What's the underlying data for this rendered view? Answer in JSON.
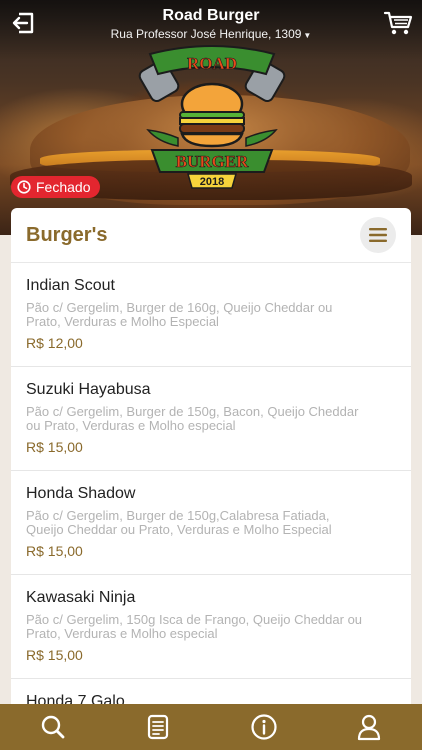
{
  "header": {
    "store_name": "Road Burger",
    "address": "Rua Professor José Henrique, 1309"
  },
  "logo": {
    "line1": "ROAD",
    "line2": "BURGER",
    "year": "2018"
  },
  "status": {
    "label": "Fechado",
    "color": "#e3262f"
  },
  "category": {
    "title": "Burger's"
  },
  "items": [
    {
      "name": "Indian Scout",
      "desc_line1": "Pão c/ Gergelim, Burger de 160g, Queijo Cheddar ou",
      "desc_line2": "Prato, Verduras e Molho Especial",
      "price": "R$ 12,00"
    },
    {
      "name": "Suzuki Hayabusa",
      "desc_line1": "Pão c/ Gergelim, Burger de 150g, Bacon, Queijo Cheddar",
      "desc_line2": "ou Prato, Verduras e Molho especial",
      "price": "R$ 15,00"
    },
    {
      "name": "Honda Shadow",
      "desc_line1": "Pão c/ Gergelim, Burger de 150g,Calabresa Fatiada,",
      "desc_line2": "Queijo Cheddar ou Prato, Verduras e Molho Especial",
      "price": "R$ 15,00"
    },
    {
      "name": "Kawasaki Ninja",
      "desc_line1": "Pão c/ Gergelim, 150g Isca de Frango, Queijo Cheddar ou",
      "desc_line2": "Prato, Verduras e Molho especial",
      "price": "R$ 15,00"
    },
    {
      "name": "Honda 7 Galo",
      "desc_line1": "",
      "desc_line2": "",
      "price": ""
    }
  ],
  "nav": {
    "icons": [
      "search-icon",
      "menu-list-icon",
      "info-icon",
      "profile-icon"
    ]
  },
  "colors": {
    "accent": "#8a6a2c",
    "status_closed": "#e3262f"
  }
}
